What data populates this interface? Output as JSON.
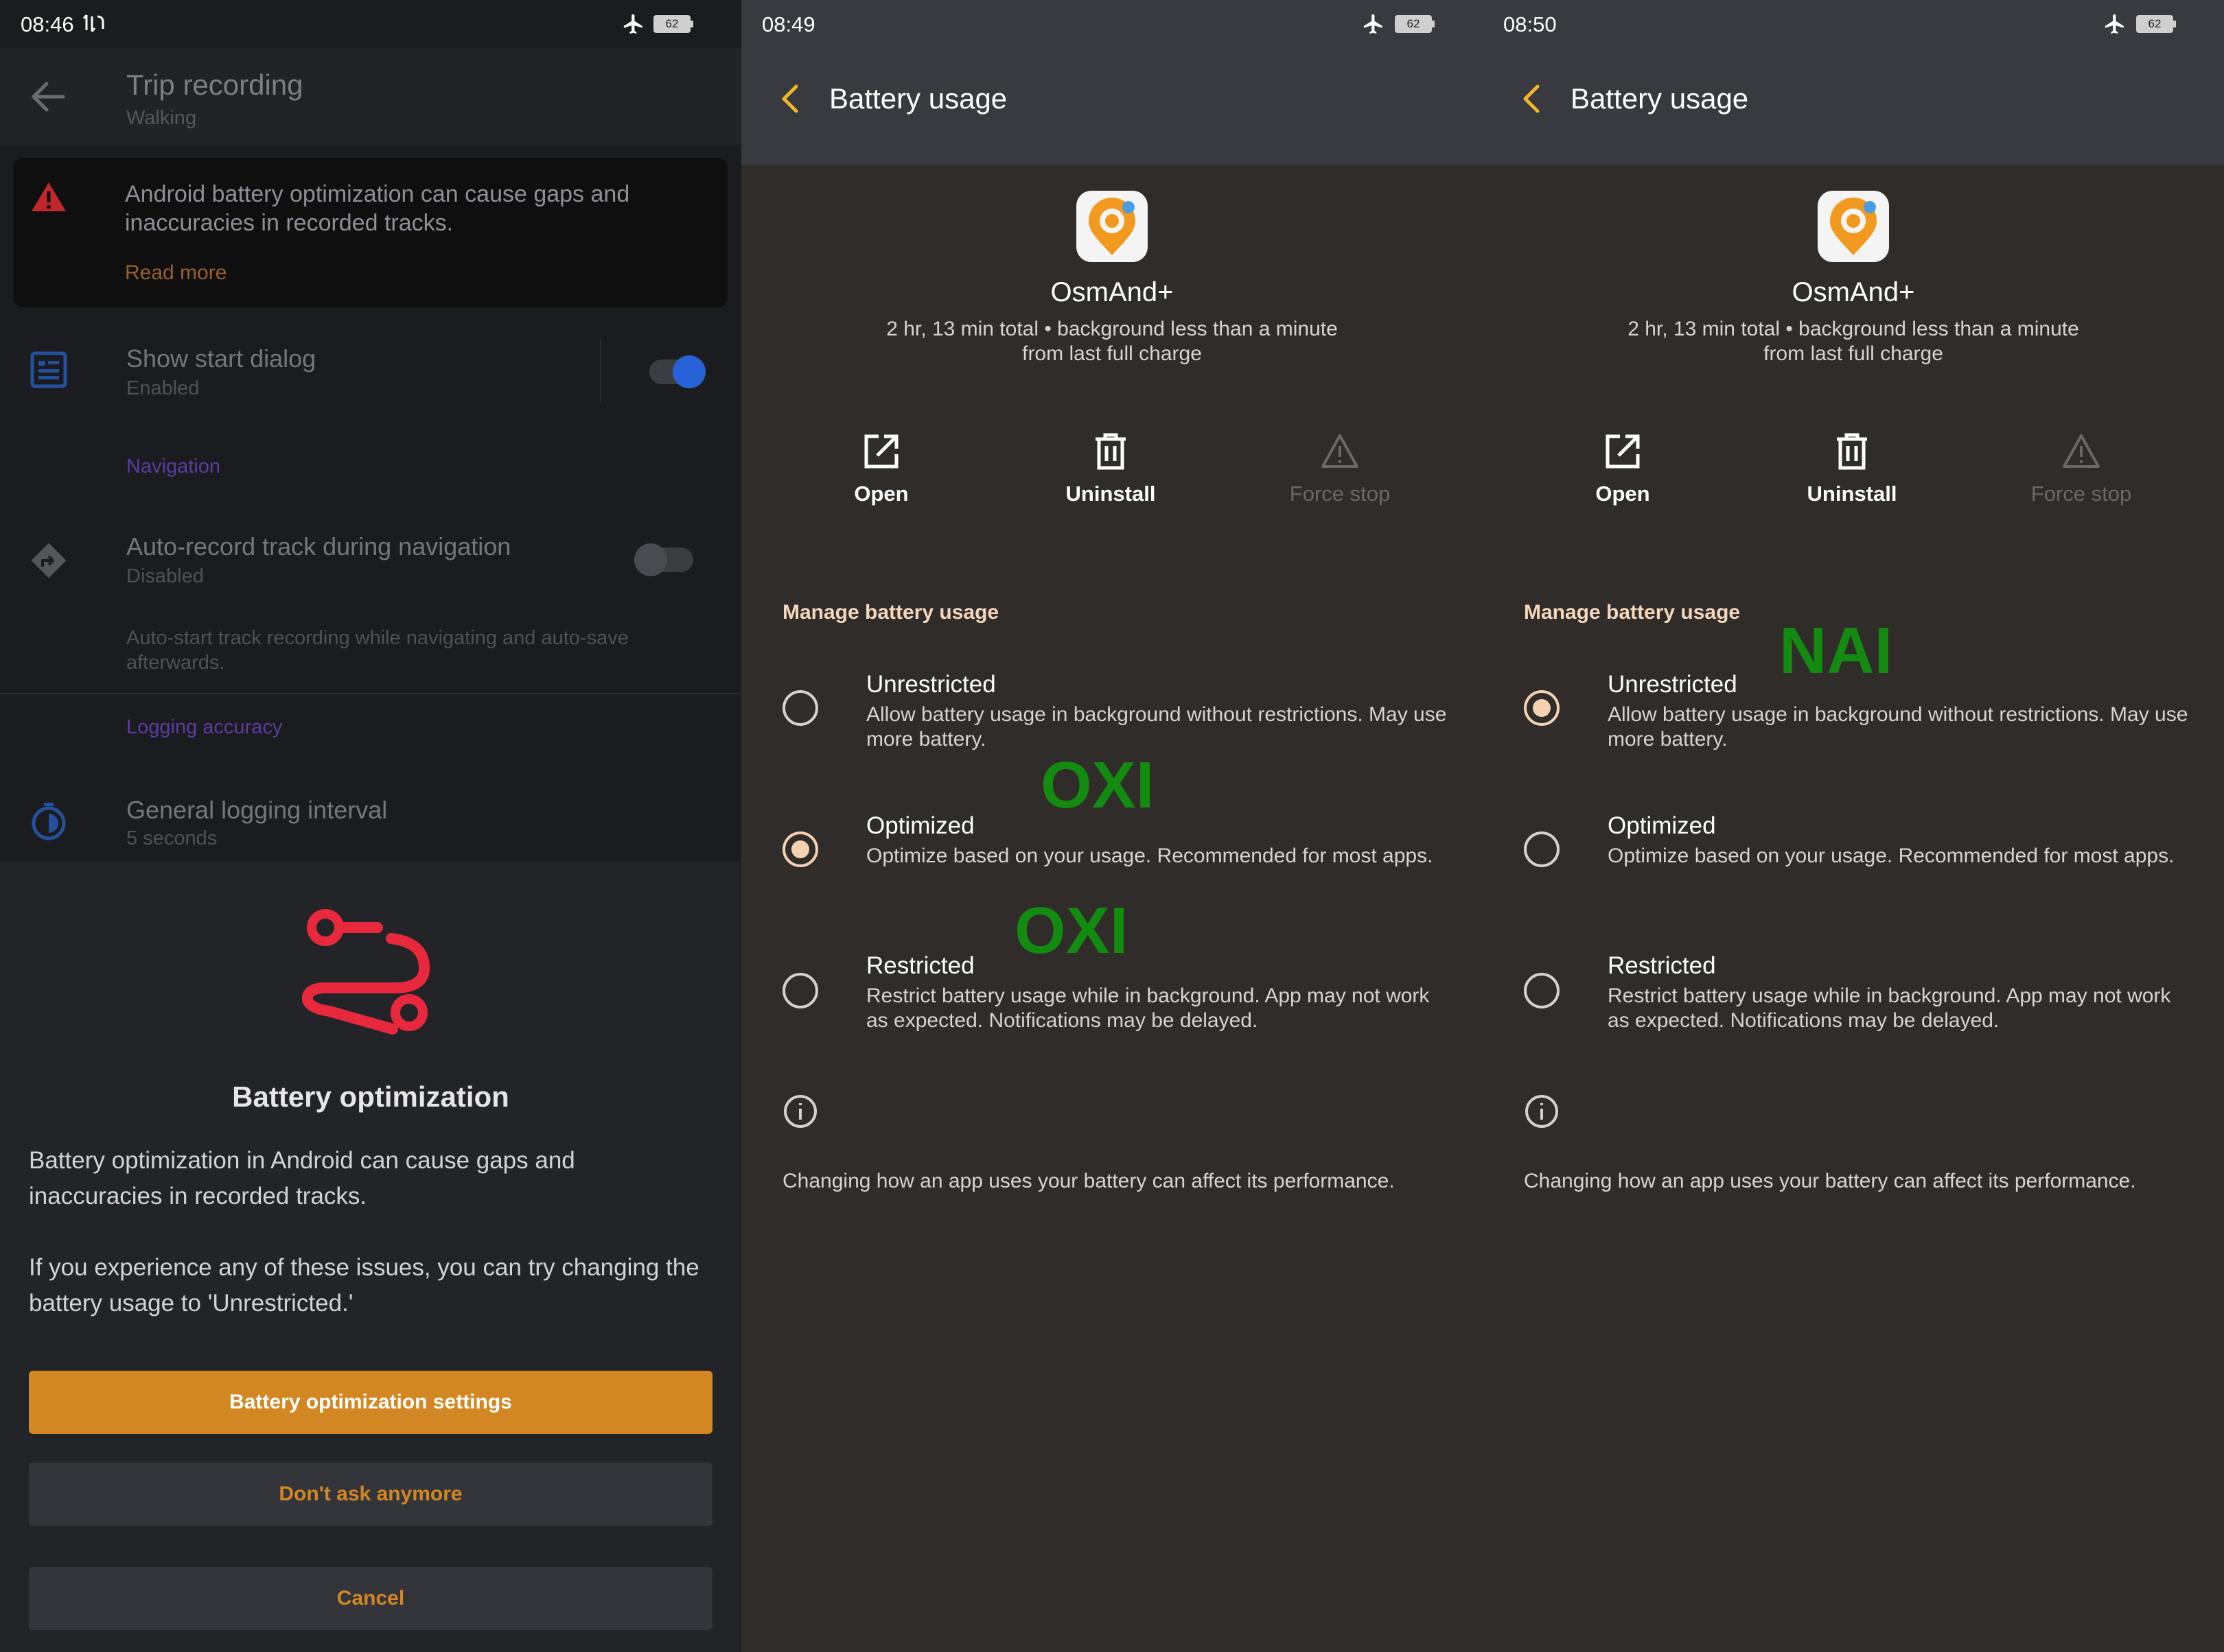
{
  "colors": {
    "accent_orange": "#d38722",
    "annotation_green": "#138a10",
    "route_red": "#e8283c",
    "toggle_blue": "#2762d9"
  },
  "panel1": {
    "time": "08:46",
    "battery": "62",
    "toolbar": {
      "title": "Trip recording",
      "subtitle": "Walking"
    },
    "warning": {
      "text": "Android battery optimization can cause gaps and inaccuracies in recorded tracks.",
      "link": "Read more"
    },
    "show_start_dialog": {
      "title": "Show start dialog",
      "value": "Enabled",
      "toggle_on": true
    },
    "sections": {
      "navigation": "Navigation",
      "logging": "Logging accuracy"
    },
    "auto_record": {
      "title": "Auto-record track during navigation",
      "value": "Disabled",
      "toggle_on": false,
      "description": "Auto-start track recording while navigating and auto-save afterwards."
    },
    "logging_interval": {
      "title": "General logging interval",
      "value": "5 seconds"
    },
    "sheet": {
      "title": "Battery optimization",
      "paragraph1": "Battery optimization in Android can cause gaps and inaccuracies in recorded tracks.",
      "paragraph2": "If you experience any of these issues, you can try changing the battery usage to 'Unrestricted.'",
      "primary_button": "Battery optimization settings",
      "secondary_button": "Don't ask anymore",
      "cancel_button": "Cancel"
    }
  },
  "panel2": {
    "time": "08:49",
    "battery": "62",
    "title": "Battery usage",
    "app_name": "OsmAnd+",
    "app_info_line1": "2 hr, 13 min total • background less than a minute",
    "app_info_line2": "from last full charge",
    "actions": {
      "open": "Open",
      "uninstall": "Uninstall",
      "force_stop": "Force stop"
    },
    "manage_header": "Manage battery usage",
    "options": [
      {
        "title": "Unrestricted",
        "desc": "Allow battery usage in background without restrictions. May use more battery.",
        "checked": false
      },
      {
        "title": "Optimized",
        "desc": "Optimize based on your usage. Recommended for most apps.",
        "checked": true
      },
      {
        "title": "Restricted",
        "desc": "Restrict battery usage while in background. App may not work as expected. Notifications may be delayed.",
        "checked": false
      }
    ],
    "footer": "Changing how an app uses your battery can affect its performance.",
    "annotations": [
      "OXI",
      "OXI"
    ]
  },
  "panel3": {
    "time": "08:50",
    "battery": "62",
    "title": "Battery usage",
    "app_name": "OsmAnd+",
    "app_info_line1": "2 hr, 13 min total • background less than a minute",
    "app_info_line2": "from last full charge",
    "actions": {
      "open": "Open",
      "uninstall": "Uninstall",
      "force_stop": "Force stop"
    },
    "manage_header": "Manage battery usage",
    "options": [
      {
        "title": "Unrestricted",
        "desc": "Allow battery usage in background without restrictions. May use more battery.",
        "checked": true
      },
      {
        "title": "Optimized",
        "desc": "Optimize based on your usage. Recommended for most apps.",
        "checked": false
      },
      {
        "title": "Restricted",
        "desc": "Restrict battery usage while in background. App may not work as expected. Notifications may be delayed.",
        "checked": false
      }
    ],
    "footer": "Changing how an app uses your battery can affect its performance.",
    "annotations": [
      "NAI"
    ]
  },
  "icons": {
    "back": "arrow-left-icon",
    "warning": "warning-triangle-icon",
    "start_dialog": "dialog-icon",
    "auto_record": "navigation-icon",
    "logging": "timer-icon",
    "route": "route-icon",
    "open": "open-external-icon",
    "uninstall": "trash-icon",
    "force_stop": "alert-triangle-icon",
    "info": "info-icon"
  }
}
